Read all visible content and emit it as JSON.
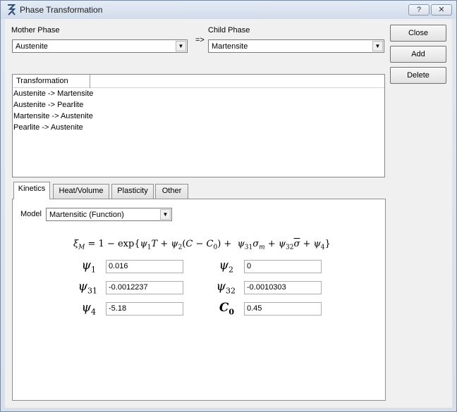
{
  "window": {
    "title": "Phase Transformation",
    "help_label": "?",
    "close_glyph": "✕"
  },
  "mother_phase": {
    "label": "Mother Phase",
    "value": "Austenite"
  },
  "arrow": "=>",
  "child_phase": {
    "label": "Child Phase",
    "value": "Martensite"
  },
  "buttons": {
    "close": "Close",
    "add": "Add",
    "delete": "Delete"
  },
  "transformations": {
    "header": "Transformation",
    "items": [
      "Austenite -> Martensite",
      "Austenite -> Pearlite",
      "Martensite -> Austenite",
      "Pearlite -> Austenite"
    ]
  },
  "tabs": [
    "Kinetics",
    "Heat/Volume",
    "Plasticity",
    "Other"
  ],
  "kinetics": {
    "model_label": "Model",
    "model_value": "Martensitic (Function)",
    "params": {
      "psi1": {
        "symbol": "ψ",
        "sub": "1",
        "value": "0.016"
      },
      "psi2": {
        "symbol": "ψ",
        "sub": "2",
        "value": "0"
      },
      "psi31": {
        "symbol": "ψ",
        "sub": "31",
        "value": "-0.0012237"
      },
      "psi32": {
        "symbol": "ψ",
        "sub": "32",
        "value": "-0.0010303"
      },
      "psi4": {
        "symbol": "ψ",
        "sub": "4",
        "value": "-5.18"
      },
      "c0": {
        "symbol": "C",
        "sub": "0",
        "value": "0.45"
      }
    }
  }
}
